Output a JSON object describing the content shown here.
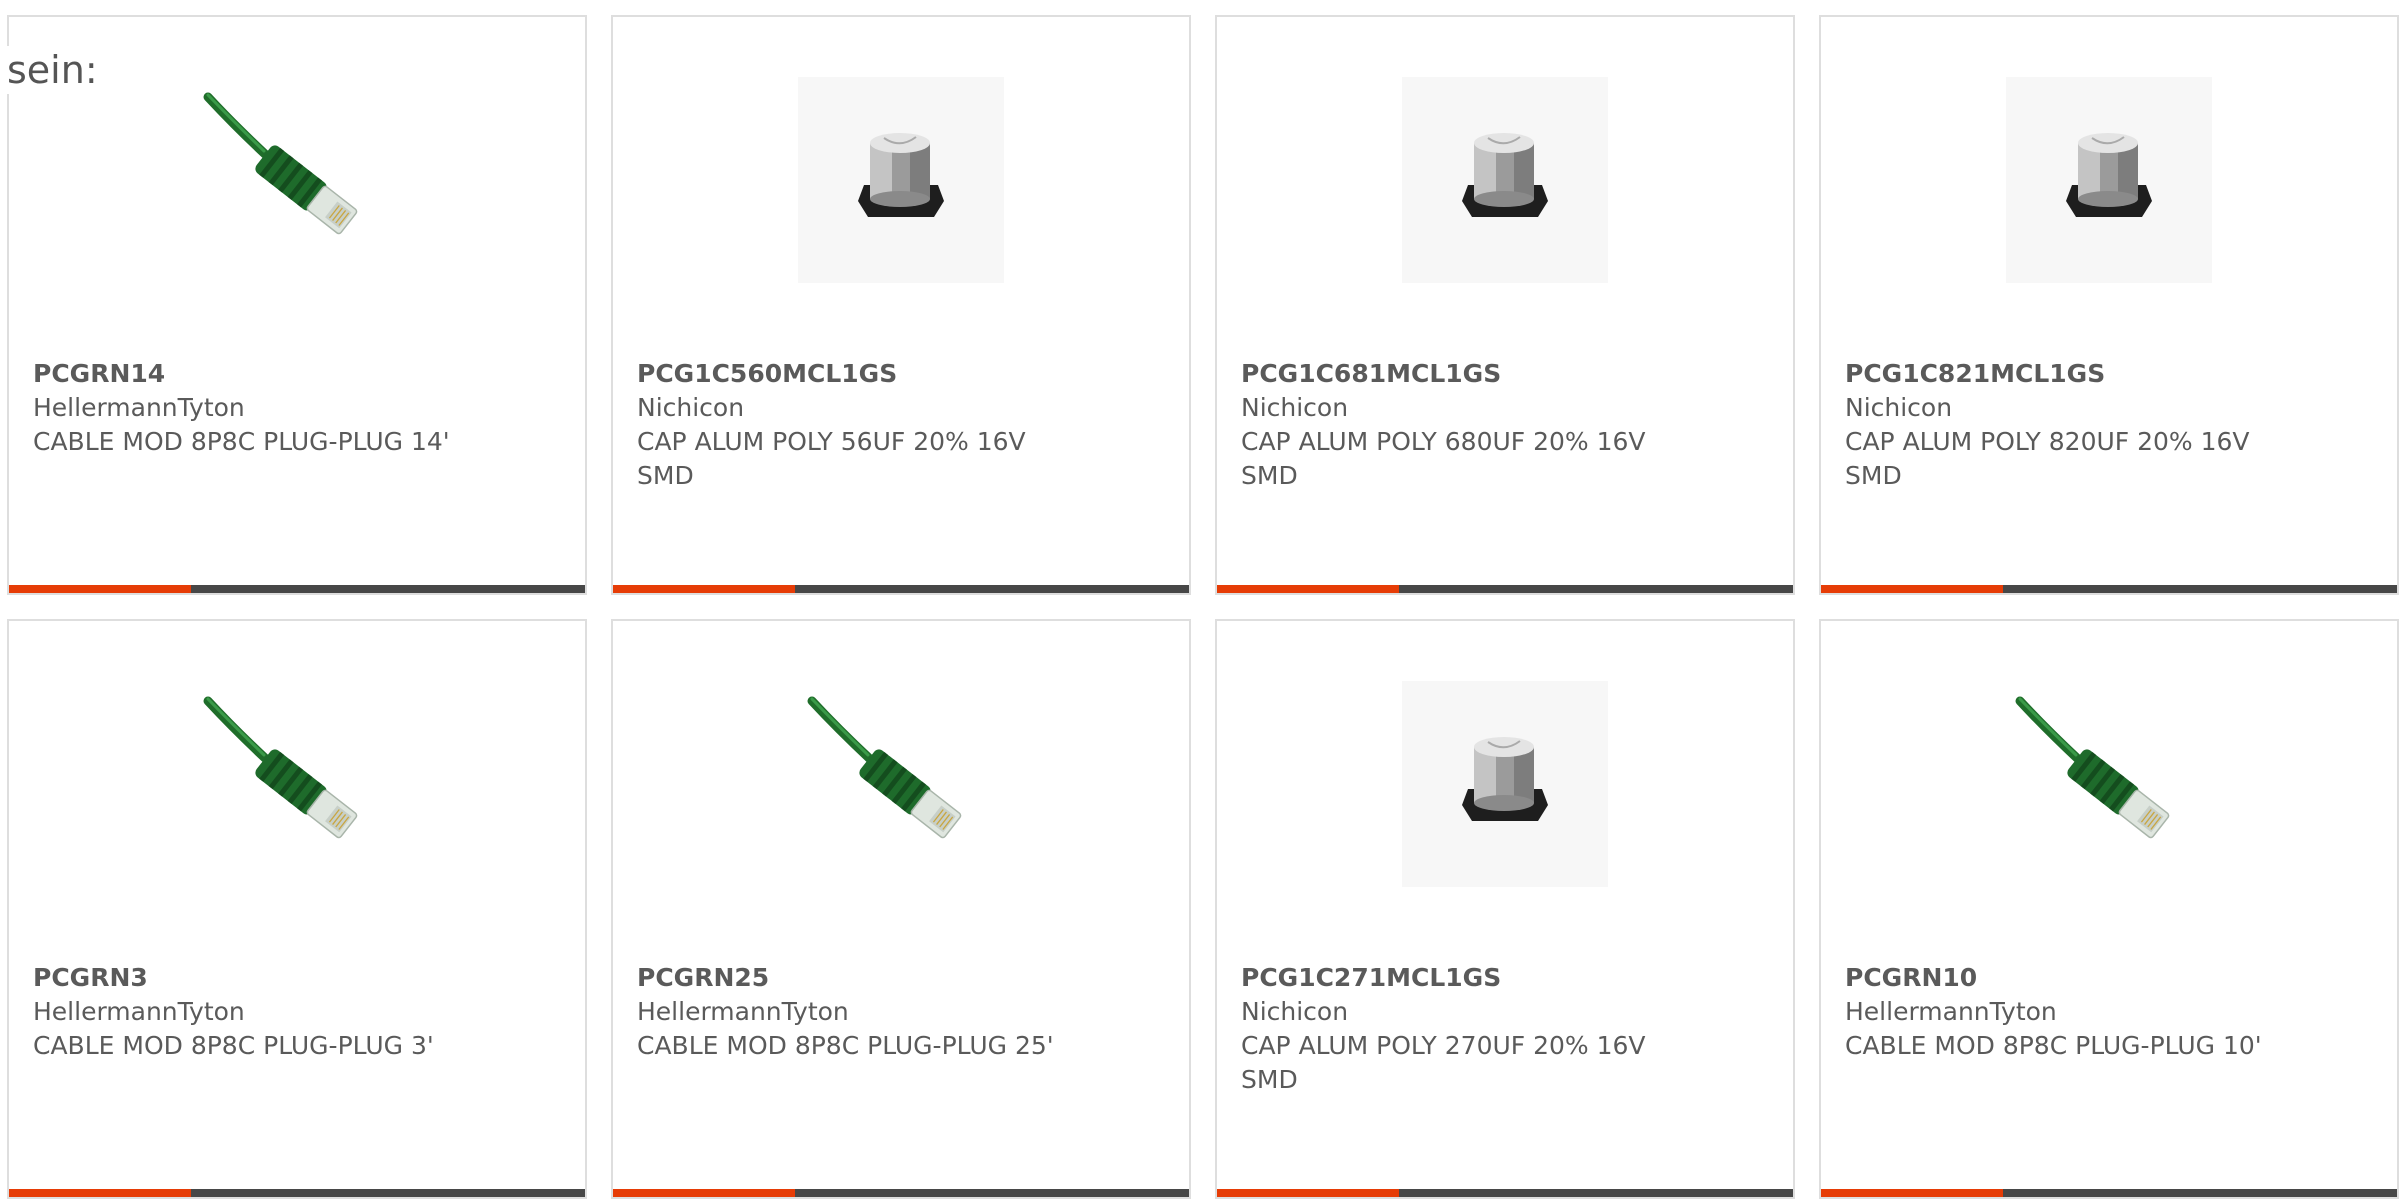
{
  "intro_text": "sein:",
  "accent_color": "#e63c06",
  "bar_dark_color": "#474747",
  "products": [
    {
      "part_number": "PCGRN14",
      "manufacturer": "HellermannTyton",
      "description": "CABLE MOD 8P8C PLUG-PLUG 14'",
      "image": "ethernet-cable-green"
    },
    {
      "part_number": "PCG1C560MCL1GS",
      "manufacturer": "Nichicon",
      "description": "CAP ALUM POLY 56UF 20% 16V SMD",
      "image": "smd-capacitor"
    },
    {
      "part_number": "PCG1C681MCL1GS",
      "manufacturer": "Nichicon",
      "description": "CAP ALUM POLY 680UF 20% 16V SMD",
      "image": "smd-capacitor"
    },
    {
      "part_number": "PCG1C821MCL1GS",
      "manufacturer": "Nichicon",
      "description": "CAP ALUM POLY 820UF 20% 16V SMD",
      "image": "smd-capacitor"
    },
    {
      "part_number": "PCGRN3",
      "manufacturer": "HellermannTyton",
      "description": "CABLE MOD 8P8C PLUG-PLUG 3'",
      "image": "ethernet-cable-green"
    },
    {
      "part_number": "PCGRN25",
      "manufacturer": "HellermannTyton",
      "description": "CABLE MOD 8P8C PLUG-PLUG 25'",
      "image": "ethernet-cable-green"
    },
    {
      "part_number": "PCG1C271MCL1GS",
      "manufacturer": "Nichicon",
      "description": "CAP ALUM POLY 270UF 20% 16V SMD",
      "image": "smd-capacitor"
    },
    {
      "part_number": "PCGRN10",
      "manufacturer": "HellermannTyton",
      "description": "CABLE MOD 8P8C PLUG-PLUG 10'",
      "image": "ethernet-cable-green"
    }
  ]
}
